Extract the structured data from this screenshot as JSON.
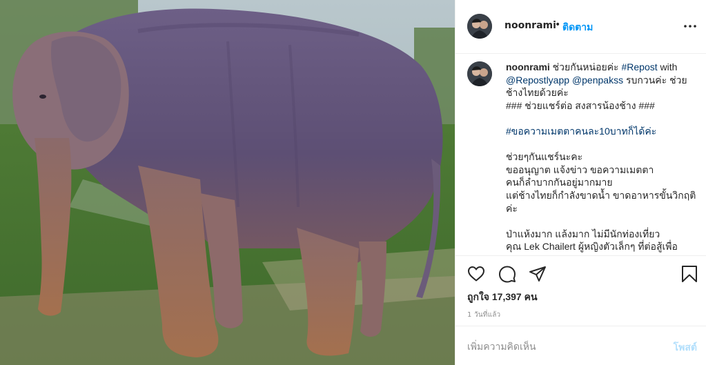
{
  "photo": {
    "subject": "emaciated-elephant-photo"
  },
  "header": {
    "username": "noonrami",
    "separator": "•",
    "follow_label": "ติดตาม"
  },
  "caption": {
    "username": "noonrami",
    "line1_text": " ช่วยกันหน่อยค่ะ ",
    "repost_tag": "#Repost",
    "with_text": " with ",
    "mention1": "@Repostlyapp",
    "space": " ",
    "mention2": "@penpakss",
    "line2_text": " รบกวนค่ะ ช่วยช้างไทยด้วยค่ะ\n### ช่วยแชร์ต่อ สงสารน้องช้าง ###\n\n",
    "hashtag2": "#ขอความเมตตาคนละ10บาทก็ได้ค่ะ",
    "body_text": "\n\nช่วยๆกันแชร์นะคะ\nขออนุญาต แจ้งข่าว ขอความเมตตา\nคนก็ลำบากกันอยู่มากมาย\nแต่ช้างไทยก็กำลังขาดน้ำ ขาดอาหารขั้นวิกฤติค่ะ\n\nป่าแห้งมาก แล้งมาก ไม่มีนักท่องเที่ยว\nคุณ Lek Chailert ผู้หญิงตัวเล็กๆ ที่ต่อสู้เพื่อ"
  },
  "actions": {
    "like_icon": "heart-icon",
    "comment_icon": "comment-icon",
    "share_icon": "paper-plane-icon",
    "save_icon": "bookmark-icon"
  },
  "likes_text": "ถูกใจ 17,397 คน",
  "time_text": "1 วันที่แล้ว",
  "comment": {
    "placeholder": "เพิ่มความคิดเห็น",
    "post_label": "โพสต์"
  },
  "colors": {
    "link_blue": "#0095f6",
    "hashtag": "#00376b",
    "post_disabled": "#b2dffc",
    "meta_gray": "#8e8e8e"
  }
}
